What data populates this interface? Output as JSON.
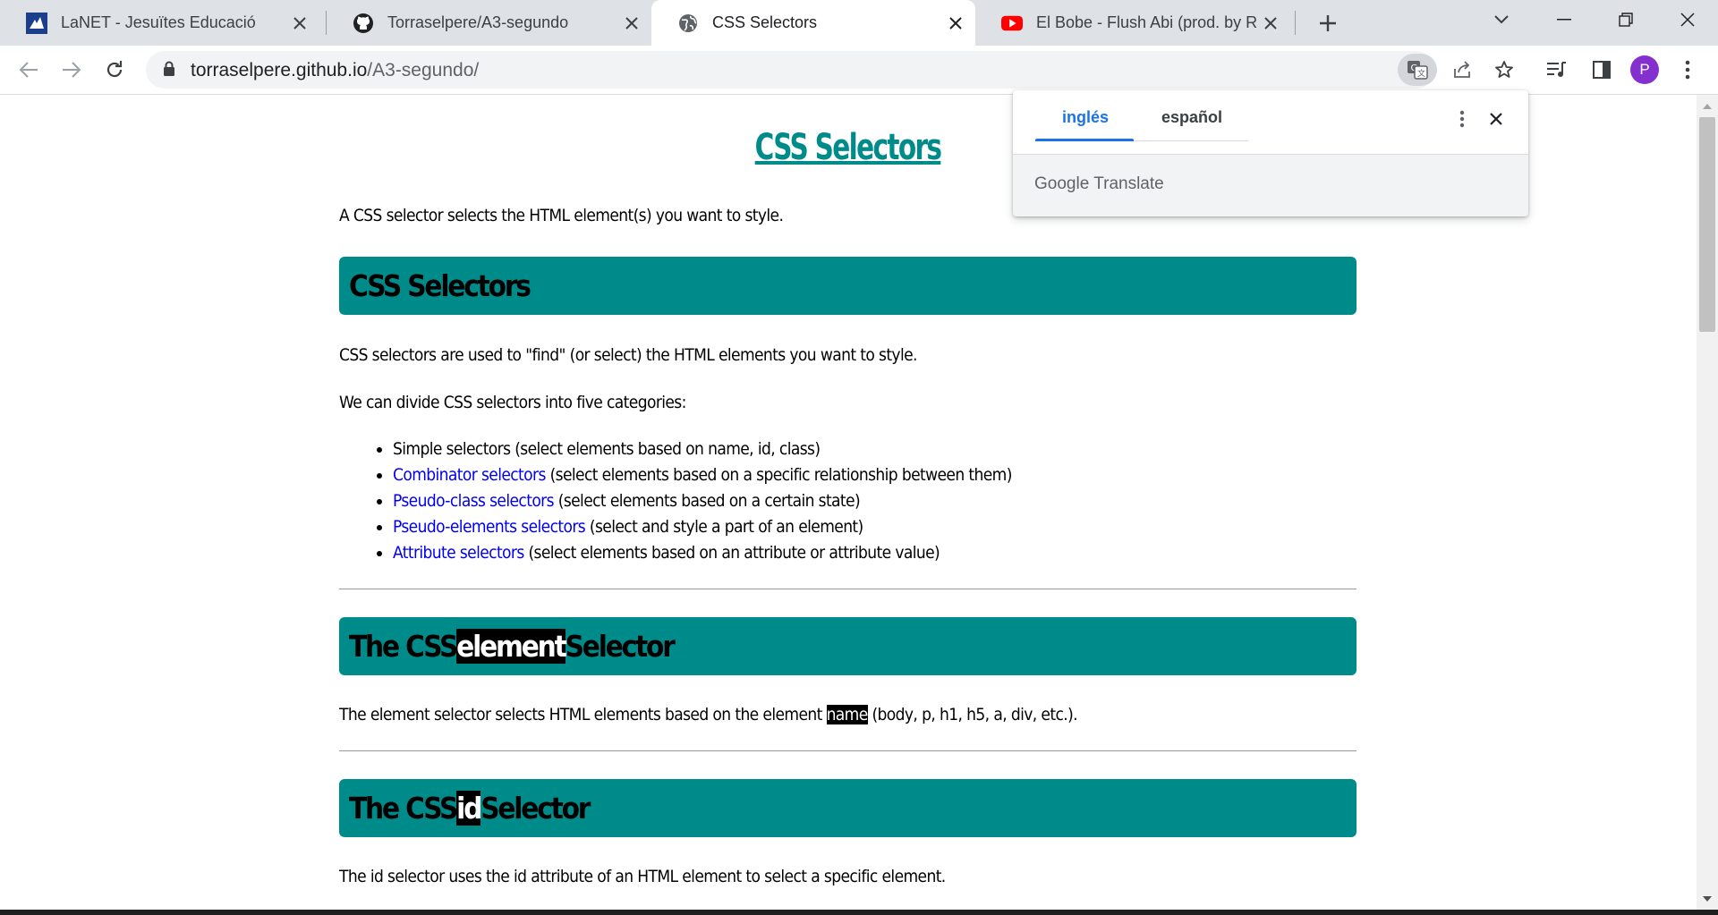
{
  "browser": {
    "tabs": [
      {
        "title": "LaNET - Jesuïtes Educació",
        "favicon": "lanet-icon",
        "active": false
      },
      {
        "title": "Torraselpere/A3-segundo",
        "favicon": "github-icon",
        "active": false
      },
      {
        "title": "CSS Selectors",
        "favicon": "globe-icon",
        "active": true
      },
      {
        "title": "El Bobe - Flush Abi (prod. by Rap",
        "favicon": "youtube-icon",
        "active": false
      }
    ],
    "url": {
      "domain": "torraselpere.github.io",
      "path": "/A3-segundo/"
    },
    "profile_initial": "P"
  },
  "translate_popup": {
    "source_language": "inglés",
    "target_language": "español",
    "brand_google": "Google",
    "brand_translate": "Translate"
  },
  "page": {
    "title": "CSS Selectors",
    "intro": "A CSS selector selects the HTML element(s) you want to style.",
    "section1": {
      "heading": "CSS Selectors",
      "p1": "CSS selectors are used to \"find\" (or select) the HTML elements you want to style.",
      "p2": "We can divide CSS selectors into five categories:",
      "categories": [
        {
          "link": "",
          "text": "Simple selectors (select elements based on name, id, class)"
        },
        {
          "link": "Combinator selectors",
          "text": " (select elements based on a specific relationship between them)"
        },
        {
          "link": "Pseudo-class selectors",
          "text": " (select elements based on a certain state)"
        },
        {
          "link": "Pseudo-elements selectors",
          "text": " (select and style a part of an element)"
        },
        {
          "link": "Attribute selectors",
          "text": " (select elements based on an attribute or attribute value)"
        }
      ]
    },
    "section2": {
      "heading_pre": "The CSS ",
      "heading_hl": "element",
      "heading_post": " Selector",
      "p_pre": "The element selector selects HTML elements based on the element ",
      "p_hl": "name",
      "p_post": " (body, p, h1, h5, a, div, etc.)."
    },
    "section3": {
      "heading_pre": "The CSS ",
      "heading_hl": "id",
      "heading_post": " Selector",
      "p": "The id selector uses the id attribute of an HTML element to select a specific element."
    }
  },
  "colors": {
    "accent_teal": "#008b8b",
    "link_blue": "#0000ee",
    "translate_blue": "#1a73e8",
    "profile_purple": "#8430ce"
  }
}
